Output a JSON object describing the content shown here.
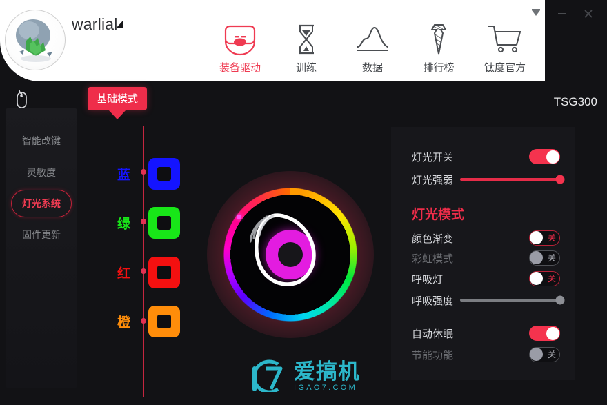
{
  "window": {
    "controls": [
      {
        "name": "collapse",
        "glyph": "collapse-icon"
      },
      {
        "name": "minimize",
        "glyph": "minimize-icon"
      },
      {
        "name": "close",
        "glyph": "close-icon"
      }
    ]
  },
  "header": {
    "username": "warlial",
    "avatar_alt": "dragon-egg-avatar"
  },
  "nav": {
    "items": [
      {
        "label": "装备驱动",
        "icon": "mouse-device-icon",
        "active": true
      },
      {
        "label": "训练",
        "icon": "hourglass-icon",
        "active": false
      },
      {
        "label": "数据",
        "icon": "curve-chart-icon",
        "active": false
      },
      {
        "label": "排行榜",
        "icon": "necktie-icon",
        "active": false
      },
      {
        "label": "钛度官方",
        "icon": "shopping-cart-icon",
        "active": false
      }
    ]
  },
  "sidebar": {
    "device_icon": "mouse-outline-icon",
    "items": [
      {
        "label": "智能改键",
        "active": false
      },
      {
        "label": "灵敏度",
        "active": false
      },
      {
        "label": "灯光系统",
        "active": true
      },
      {
        "label": "固件更新",
        "active": false
      }
    ]
  },
  "workspace": {
    "mode_badge": "基础模式",
    "device_model": "TSG300",
    "color_presets": [
      {
        "label": "蓝",
        "color": "#1414ff"
      },
      {
        "label": "绿",
        "color": "#18e618"
      },
      {
        "label": "红",
        "color": "#f41010"
      },
      {
        "label": "橙",
        "color": "#ff8d0a"
      }
    ],
    "wheel": {
      "selected_color": "#e31ce0",
      "picker_hex": "#ff4df0"
    }
  },
  "panel": {
    "rows": [
      {
        "label": "灯光开关",
        "control": "toggle",
        "state": "on",
        "dim": false
      },
      {
        "label": "灯光强弱",
        "control": "slider",
        "state": "red",
        "value": 100,
        "dim": false
      }
    ],
    "mode_heading": "灯光模式",
    "mode_rows": [
      {
        "label": "颜色渐变",
        "control": "toggle",
        "state": "off",
        "off_text": "关",
        "dim": false
      },
      {
        "label": "彩虹模式",
        "control": "toggle",
        "state": "disabled",
        "off_text": "关",
        "dim": true
      },
      {
        "label": "呼吸灯",
        "control": "toggle",
        "state": "off",
        "off_text": "关",
        "dim": false
      },
      {
        "label": "呼吸强度",
        "control": "slider",
        "state": "gray",
        "value": 100,
        "dim": false
      }
    ],
    "power_rows": [
      {
        "label": "自动休眠",
        "control": "toggle",
        "state": "on",
        "dim": false
      },
      {
        "label": "节能功能",
        "control": "toggle",
        "state": "disabled",
        "off_text": "关",
        "dim": true
      }
    ]
  },
  "watermark": {
    "logo": "i7",
    "cn": "爱搞机",
    "en": "IGAO7.COM",
    "color": "#2fc4d8"
  },
  "colors": {
    "accent_red": "#ef2d4a",
    "panel_bg": "#17171b",
    "app_bg": "#121215"
  }
}
